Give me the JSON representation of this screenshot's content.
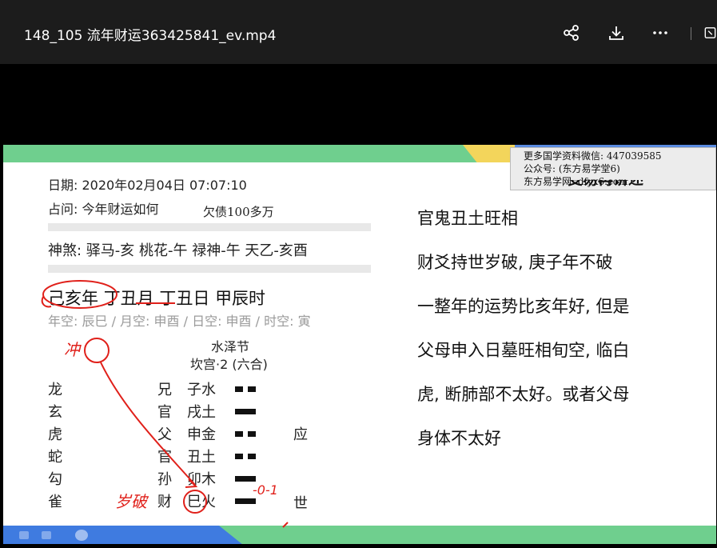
{
  "window": {
    "title": "148_105 流年财运363425841_ev.mp4",
    "icons": [
      "share-icon",
      "download-icon",
      "more-icon",
      "exit-fullscreen-icon"
    ]
  },
  "slide": {
    "watermark": "更多国学资料微信: 447039585\n公众号: (东方易学堂6)\n东方易学网: dfyx6.com",
    "header_partial": "变易再讲述",
    "date": "日期: 2020年02月04日 07:07:10",
    "question": "占问: 今年财运如何",
    "question_note": "欠债100多万",
    "shensha": "神煞: 驿马-亥 桃花-午 禄神-午 天乙-亥酉",
    "ganzhi": [
      "己亥年",
      "丁丑月",
      "丁丑日",
      "甲辰时"
    ],
    "kong": "年空: 辰巳 / 月空: 申酉 / 日空: 申酉 / 时空: 寅",
    "hexagram_name": "水泽节",
    "hexagram_palace": "坎宫·2 (六合)",
    "beasts": [
      "龙",
      "玄",
      "虎",
      "蛇",
      "勾",
      "雀"
    ],
    "relations": [
      "兄",
      "官",
      "父",
      "官",
      "孙",
      "财"
    ],
    "branches": [
      "子水",
      "戌土",
      "申金",
      "丑土",
      "卯木",
      "巳火"
    ],
    "lines": [
      "yin",
      "yang",
      "yin",
      "yin",
      "yang",
      "yang"
    ],
    "markers": [
      "",
      "",
      "应",
      "",
      "",
      "世"
    ],
    "right_text": [
      "官鬼丑土旺相",
      "财爻持世岁破, 庚子年不破",
      "一整年的运势比亥年好, 但是",
      "父母申入日墓旺相旬空, 临白",
      "虎, 断肺部不太好。或者父母",
      "身体不太好"
    ],
    "handwriting": [
      "冲",
      "岁破",
      "-0-1"
    ]
  },
  "colors": {
    "titlebar_bg": "#1c1c1c",
    "band_green": "#6fcf8e",
    "band_blue": "#3f7be0",
    "band_yellow": "#f3d55b",
    "ink_red": "#e0201a"
  }
}
